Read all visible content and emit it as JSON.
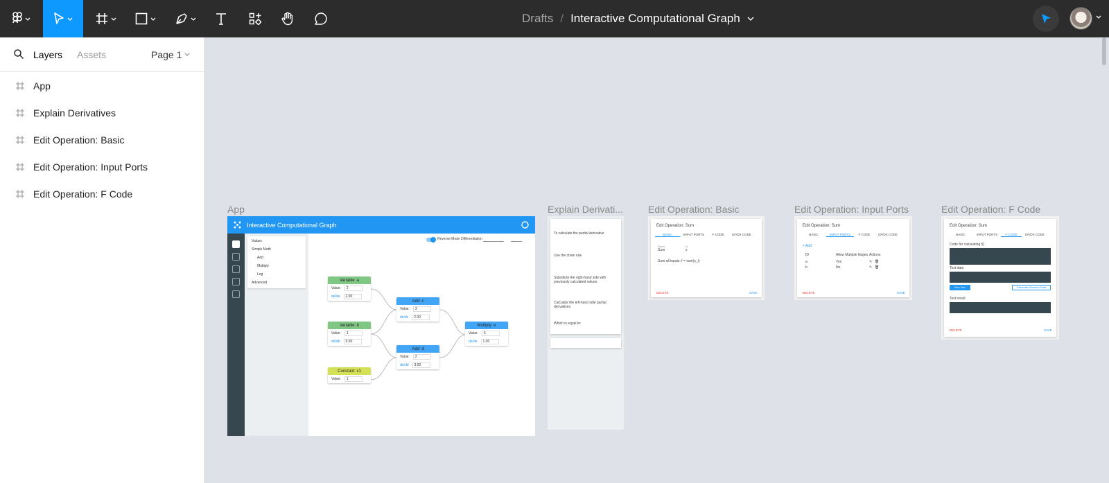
{
  "toolbar": {
    "tools": [
      "figma-menu",
      "move",
      "frame",
      "shape",
      "pen",
      "text",
      "resources",
      "hand",
      "comment"
    ],
    "breadcrumb": {
      "parent": "Drafts",
      "separator": "/",
      "title": "Interactive Computational Graph"
    },
    "colors": {
      "bar": "#2c2c2c",
      "active": "#0d99ff"
    }
  },
  "left_panel": {
    "tabs": {
      "layers": "Layers",
      "assets": "Assets"
    },
    "page": "Page 1",
    "layers": [
      "App",
      "Explain Derivatives",
      "Edit Operation: Basic",
      "Edit Operation: Input Ports",
      "Edit Operation: F Code"
    ]
  },
  "canvas": {
    "background": "#dfe1e8",
    "frames": {
      "app": {
        "label": "App",
        "title": "Interactive Computational Graph",
        "switch_label": "Reverse-Mode Differentiation",
        "sidebar": {
          "values": "Values",
          "simple_math": "Simple Math",
          "add": "Add",
          "multiply": "Multiply",
          "log": "Log",
          "advanced": "Advanced"
        },
        "nodes": {
          "a": {
            "title": "Variable: a",
            "value_label": "Value:",
            "value": "2",
            "deriv_label": "de/da",
            "deriv": "2.00"
          },
          "b": {
            "title": "Variable: b",
            "value_label": "Value:",
            "value": "1",
            "deriv_label": "de/db",
            "deriv": "5.00"
          },
          "c1": {
            "title": "Constant: c1",
            "value_label": "Value:",
            "value": "1"
          },
          "c": {
            "title": "Add: c",
            "value_label": "Value:",
            "value": "3",
            "deriv_label": "de/dc",
            "deriv": "2.00"
          },
          "d": {
            "title": "Add: d",
            "value_label": "Value:",
            "value": "2",
            "deriv_label": "de/dd",
            "deriv": "3.00"
          },
          "e": {
            "title": "Multiply: e",
            "value_label": "Value:",
            "value": "6",
            "deriv_label": "de/de",
            "deriv": "1.00"
          }
        },
        "colors": {
          "header": "#2196f3",
          "variable": "#81c784",
          "constant": "#d4e157",
          "operation": "#42a5f5"
        }
      },
      "explain": {
        "label": "Explain Derivati...",
        "steps": [
          "To calculate the partial derivative",
          "Use the chain rule",
          "Substitute the right-hand side with previously calculated values:",
          "Calculate the left-hand side partial derivatives:",
          "Which is equal to:"
        ]
      },
      "basic": {
        "label": "Edit Operation: Basic",
        "dialog_title": "Edit Operation: Sum",
        "tabs": [
          "BASIC",
          "INPUT PORTS",
          "F CODE",
          "DF/DX CODE"
        ],
        "fields": {
          "name_label": "Name",
          "name": "Sum",
          "id_label": "Id",
          "id": "s",
          "desc": "Sum all inputs: f = sum(x_i)"
        },
        "delete": "DELETE",
        "save": "SAVE"
      },
      "ports": {
        "label": "Edit Operation: Input Ports",
        "dialog_title": "Edit Operation: Sum",
        "tabs": [
          "BASIC",
          "INPUT PORTS",
          "F CODE",
          "DF/DX CODE"
        ],
        "add": "+ Add",
        "columns": [
          "ID",
          "Allow Multiple Edges",
          "Actions"
        ],
        "rows": [
          {
            "id": "a",
            "multi": "Yes"
          },
          {
            "id": "b",
            "multi": "No"
          }
        ],
        "delete": "DELETE",
        "save": "SAVE"
      },
      "fcode": {
        "label": "Edit Operation: F Code",
        "dialog_title": "Edit Operation: Sum",
        "tabs": [
          "BASIC",
          "INPUT PORTS",
          "F CODE",
          "DF/DX CODE"
        ],
        "code_label": "Code for calculating f()",
        "test_label": "Test data",
        "run": "Run Test",
        "random": "Generate Random Data",
        "result_label": "Test result",
        "delete": "DELETE",
        "save": "SAVE"
      }
    }
  }
}
